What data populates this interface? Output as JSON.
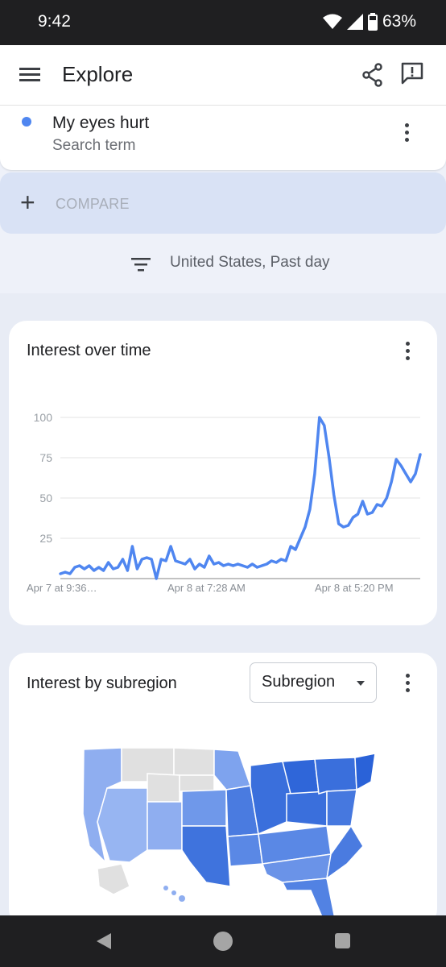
{
  "status_bar": {
    "time": "9:42",
    "battery": "63%"
  },
  "app_bar": {
    "title": "Explore"
  },
  "search_term": {
    "name": "My eyes hurt",
    "subtitle": "Search term",
    "color": "#4f86f0"
  },
  "compare": {
    "label": "COMPARE"
  },
  "filter": {
    "label": "United States, Past day"
  },
  "interest_over_time": {
    "title": "Interest over time"
  },
  "chart_data": {
    "type": "line",
    "title": "",
    "xlabel": "",
    "ylabel": "",
    "ylim": [
      0,
      100
    ],
    "y_ticks": [
      "100",
      "75",
      "50",
      "25"
    ],
    "x_tick_labels": [
      "Apr 7 at 9:36…",
      "Apr 8 at 7:28 AM",
      "Apr 8 at 5:20 PM"
    ],
    "grid": true,
    "series": [
      {
        "color": "#4f86f0",
        "values": [
          3,
          4,
          3,
          7,
          8,
          6,
          8,
          5,
          7,
          5,
          10,
          6,
          7,
          12,
          5,
          20,
          6,
          12,
          13,
          12,
          0,
          12,
          11,
          20,
          11,
          10,
          9,
          12,
          6,
          9,
          7,
          14,
          9,
          10,
          8,
          9,
          8,
          9,
          8,
          7,
          9,
          7,
          8,
          9,
          11,
          10,
          12,
          11,
          20,
          18,
          25,
          32,
          43,
          65,
          100,
          95,
          75,
          52,
          34,
          32,
          33,
          38,
          40,
          48,
          40,
          41,
          46,
          45,
          50,
          60,
          74,
          70,
          65,
          60,
          65,
          77
        ]
      }
    ]
  },
  "interest_by_subregion": {
    "title": "Interest by subregion",
    "dropdown_label": "Subregion"
  }
}
